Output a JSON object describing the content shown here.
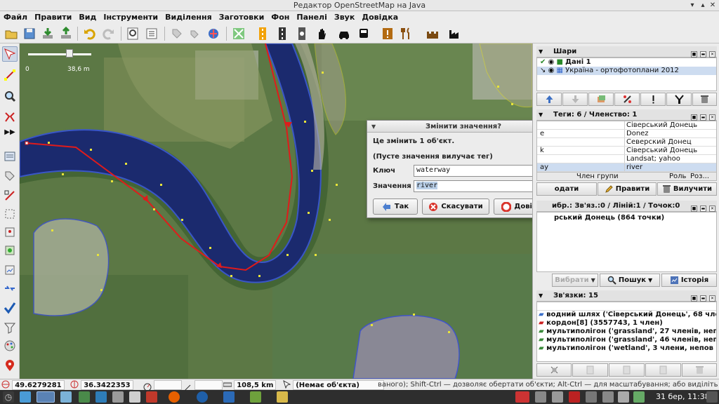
{
  "window": {
    "title": "Редактор OpenStreetMap на Java"
  },
  "menu": [
    "Файл",
    "Правити",
    "Вид",
    "Інструменти",
    "Виділення",
    "Заготовки",
    "Фон",
    "Панелі",
    "Звук",
    "Довідка"
  ],
  "toolbar_icons": [
    "open-icon",
    "save-icon",
    "download-icon",
    "upload-icon",
    "undo-icon",
    "redo-icon",
    "preferences-icon",
    "tag-icon",
    "imagery-icon",
    "zoom-icon",
    "road-icon",
    "hand-icon",
    "car-icon",
    "bus-icon",
    "warning-icon",
    "restaurant-icon",
    "castle-icon",
    "factory-icon"
  ],
  "scale": {
    "left": "0",
    "right": "38,6 m"
  },
  "dialog": {
    "title": "Змінити значення?",
    "message": "Це змінить 1 об'єкт.",
    "note": "(Пусте значення вилучає тег)",
    "key_label": "Ключ",
    "key_value": "waterway",
    "value_label": "Значення",
    "value_value": "river",
    "ok": "Так",
    "cancel": "Скасувати",
    "help": "Довідка"
  },
  "layers": {
    "title": "Шари",
    "items": [
      {
        "name": "Дані 1"
      },
      {
        "name": "Україна - ортофотоплани 2012"
      }
    ]
  },
  "tags": {
    "title": "Теги: 6 / Членство: 1",
    "rows": [
      {
        "k": "",
        "v": "Сіверський Донець"
      },
      {
        "k": "e",
        "v": "Donez"
      },
      {
        "k": "",
        "v": "Северский Донец"
      },
      {
        "k": "k",
        "v": "Сіверський Донець"
      },
      {
        "k": "",
        "v": "Landsat; yahoo"
      },
      {
        "k": "ay",
        "v": "river"
      }
    ],
    "member_header": [
      "Член групи",
      "Роль",
      "Роз..."
    ],
    "add": "одати",
    "edit": "Правити",
    "delete": "Вилучити"
  },
  "selection": {
    "title": "ибр.: Зв'яз.:0 / Ліній:1 / Точок:0",
    "item": "рський Донець (864 точки)",
    "select": "Вибрати",
    "search": "Пошук",
    "history": "Історія"
  },
  "relations": {
    "title": "Зв'язки: 15",
    "items": [
      "водний шлях ('Сіверський Донець', 68 чле",
      "кордон[8] (3557743, 1 член)",
      "мультиполігон ('grassland', 27 членів, неп",
      "мультиполігон ('grassland', 46 членів, неп",
      "мультиполігон ('wetland', 3 члени, непов"
    ]
  },
  "status": {
    "lat": "49.6279281",
    "lon": "36.3422353",
    "distance": "108,5 km",
    "object": "(Немає об'єкта)",
    "help": "ваного); Shift-Ctrl — дозволяє обертати об'єкти; Alt-Ctrl — для масштабування; або виділіть інше"
  },
  "taskbar": {
    "date": "31 бер, 11:38"
  }
}
